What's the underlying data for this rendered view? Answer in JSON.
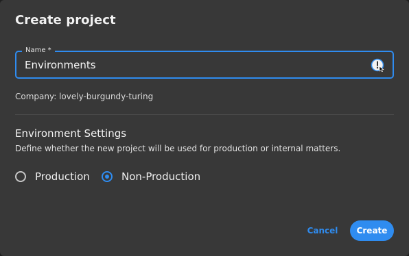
{
  "dialog": {
    "title": "Create project"
  },
  "name_field": {
    "label": "Name *",
    "value": "Environments",
    "icon": "password-manager-icon"
  },
  "company": {
    "text": "Company: lovely-burgundy-turing"
  },
  "environment_settings": {
    "title": "Environment Settings",
    "description": "Define whether the new project will be used for production or internal matters.",
    "options": [
      {
        "label": "Production",
        "selected": false
      },
      {
        "label": "Non-Production",
        "selected": true
      }
    ]
  },
  "actions": {
    "cancel_label": "Cancel",
    "create_label": "Create"
  },
  "colors": {
    "accent": "#2f8cf0",
    "background": "#383838"
  }
}
